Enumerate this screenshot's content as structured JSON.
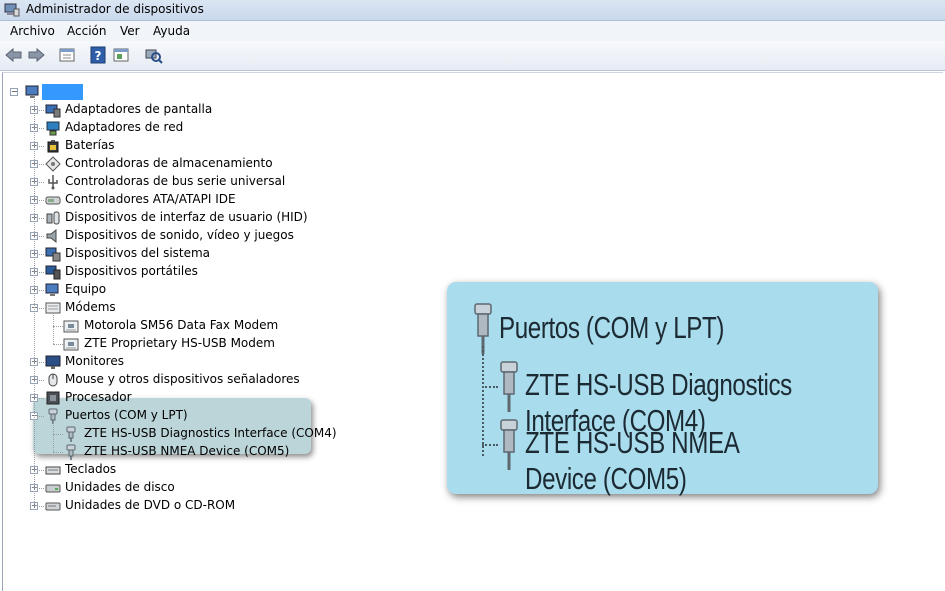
{
  "window": {
    "title": "Administrador de dispositivos"
  },
  "menu": [
    "Archivo",
    "Acción",
    "Ver",
    "Ayuda"
  ],
  "toolbar": [
    {
      "name": "back-arrow-icon"
    },
    {
      "name": "forward-arrow-icon"
    },
    {
      "name": "properties-icon"
    },
    {
      "name": "help-icon"
    },
    {
      "name": "view-icon"
    },
    {
      "name": "scan-hardware-icon"
    }
  ],
  "tree": {
    "root_label": "",
    "categories": [
      {
        "label": "Adaptadores de pantalla",
        "icon": "display-adapter-icon"
      },
      {
        "label": "Adaptadores de red",
        "icon": "network-adapter-icon"
      },
      {
        "label": "Baterías",
        "icon": "battery-icon"
      },
      {
        "label": "Controladoras de almacenamiento",
        "icon": "storage-controller-icon"
      },
      {
        "label": "Controladoras de bus serie universal",
        "icon": "usb-controller-icon"
      },
      {
        "label": "Controladores ATA/ATAPI IDE",
        "icon": "ide-controller-icon"
      },
      {
        "label": "Dispositivos de interfaz de usuario (HID)",
        "icon": "hid-icon"
      },
      {
        "label": "Dispositivos de sonido, vídeo y juegos",
        "icon": "sound-icon"
      },
      {
        "label": "Dispositivos del sistema",
        "icon": "system-device-icon"
      },
      {
        "label": "Dispositivos portátiles",
        "icon": "portable-device-icon"
      },
      {
        "label": "Equipo",
        "icon": "computer-icon"
      },
      {
        "label": "Módems",
        "icon": "modem-icon",
        "expanded": true,
        "children": [
          {
            "label": "Motorola SM56 Data Fax Modem",
            "icon": "modem-device-icon"
          },
          {
            "label": "ZTE Proprietary HS-USB Modem",
            "icon": "modem-device-icon"
          }
        ]
      },
      {
        "label": "Monitores",
        "icon": "monitor-icon"
      },
      {
        "label": "Mouse y otros dispositivos señaladores",
        "icon": "mouse-icon"
      },
      {
        "label": "Procesador",
        "icon": "processor-icon"
      },
      {
        "label": "Puertos (COM y LPT)",
        "icon": "port-icon",
        "expanded": true,
        "children": [
          {
            "label": "ZTE HS-USB Diagnostics Interface (COM4)",
            "icon": "port-icon"
          },
          {
            "label": "ZTE HS-USB NMEA Device (COM5)",
            "icon": "port-icon"
          }
        ]
      },
      {
        "label": "Teclados",
        "icon": "keyboard-icon"
      },
      {
        "label": "Unidades de disco",
        "icon": "disk-drive-icon"
      },
      {
        "label": "Unidades de DVD o CD-ROM",
        "icon": "dvd-drive-icon"
      }
    ]
  },
  "zoom": {
    "parent": "Puertos (COM y LPT)",
    "items": [
      "ZTE HS-USB Diagnostics Interface (COM4)",
      "ZTE HS-USB NMEA Device (COM5)"
    ]
  },
  "colors": {
    "highlight": "#bcd5d9",
    "zoom_panel": "#a9dcec"
  }
}
